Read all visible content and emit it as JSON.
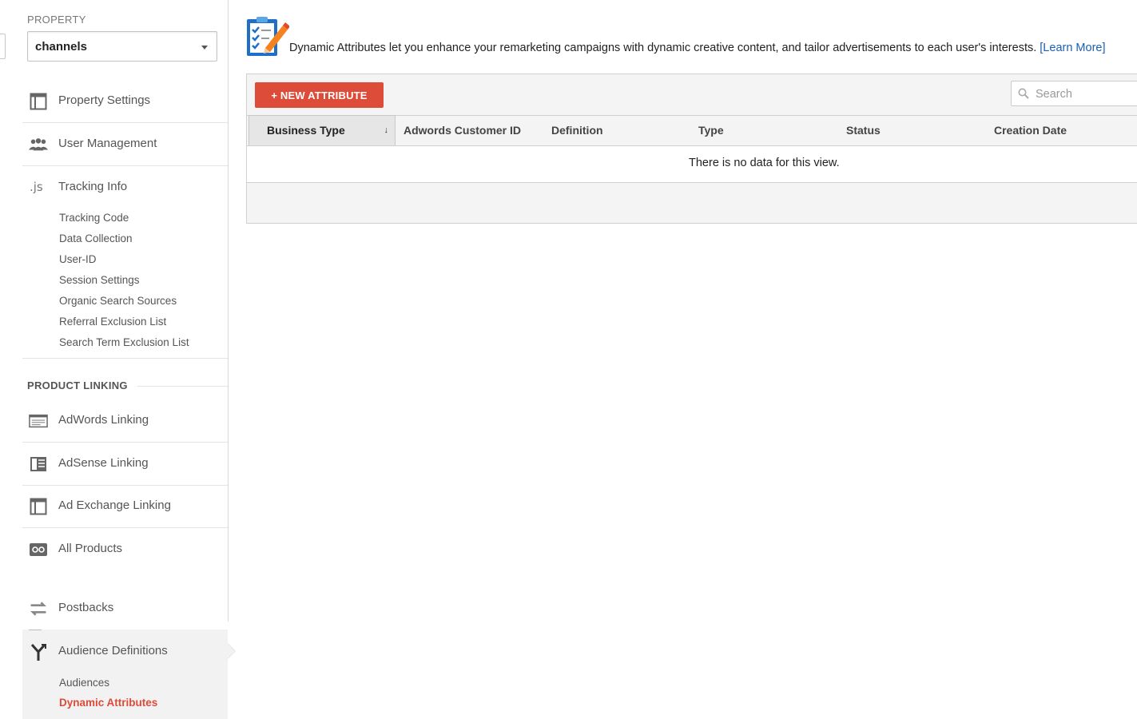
{
  "sidebar": {
    "property_caption": "PROPERTY",
    "property_selected": "channels",
    "items": [
      {
        "label": "Property Settings",
        "icon": "window-icon"
      },
      {
        "label": "User Management",
        "icon": "users-icon"
      },
      {
        "label": "Tracking Info",
        "icon": "js-icon"
      }
    ],
    "tracking_sub": [
      "Tracking Code",
      "Data Collection",
      "User-ID",
      "Session Settings",
      "Organic Search Sources",
      "Referral Exclusion List",
      "Search Term Exclusion List"
    ],
    "product_linking_caption": "PRODUCT LINKING",
    "linking_items": [
      {
        "label": "AdWords Linking",
        "icon": "adwords-icon"
      },
      {
        "label": "AdSense Linking",
        "icon": "adsense-icon"
      },
      {
        "label": "Ad Exchange Linking",
        "icon": "ad-exchange-icon"
      },
      {
        "label": "All Products",
        "icon": "all-products-icon"
      }
    ],
    "postbacks": {
      "label": "Postbacks",
      "icon": "postbacks-icon"
    },
    "audience": {
      "label": "Audience Definitions",
      "icon": "audience-fork-icon"
    },
    "audience_sub": [
      "Audiences",
      "Dynamic Attributes"
    ],
    "active_sub": "Dynamic Attributes"
  },
  "main": {
    "intro_text": "Dynamic Attributes let you enhance your remarketing campaigns with dynamic creative content, and tailor advertisements to each user's interests.",
    "learn_more": "[Learn More]",
    "new_attribute_label": "+ NEW ATTRIBUTE",
    "search_placeholder": "Search",
    "columns": [
      "Business Type",
      "Adwords Customer ID",
      "Definition",
      "Type",
      "Status",
      "Creation Date"
    ],
    "sort_indicator": "↓",
    "empty_message": "There is no data for this view."
  },
  "colors": {
    "accent_red": "#dd4b39",
    "link_blue": "#1a5fb4"
  }
}
